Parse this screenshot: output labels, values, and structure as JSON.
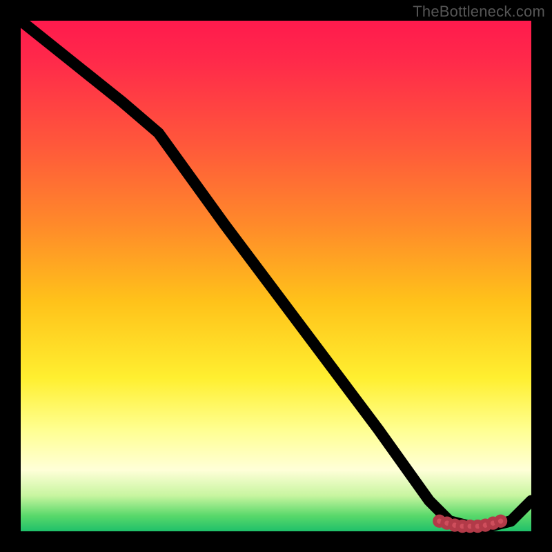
{
  "watermark": "TheBottleneck.com",
  "chart_data": {
    "type": "line",
    "title": "",
    "xlabel": "",
    "ylabel": "",
    "xlim": [
      0,
      100
    ],
    "ylim": [
      0,
      100
    ],
    "grid": false,
    "note": "Values are approximate positions read from the plot area, normalized 0–100 on each axis. The curve descends from top-left, then flattens near the bottom around x≈82–94, then rises again slightly at the right edge. The red marker cluster sits on the near-zero plateau.",
    "series": [
      {
        "name": "curve",
        "x": [
          0,
          10,
          20,
          27,
          40,
          55,
          70,
          80,
          84,
          88,
          92,
          96,
          100
        ],
        "y": [
          100,
          92,
          84,
          78,
          60,
          40,
          20,
          6,
          2,
          1,
          1,
          2,
          6
        ]
      },
      {
        "name": "markers",
        "x": [
          82,
          83.5,
          85,
          86.5,
          88,
          89.5,
          91,
          92.5,
          94
        ],
        "y": [
          2,
          1.6,
          1.2,
          1,
          1,
          1,
          1.2,
          1.6,
          2
        ]
      }
    ]
  }
}
